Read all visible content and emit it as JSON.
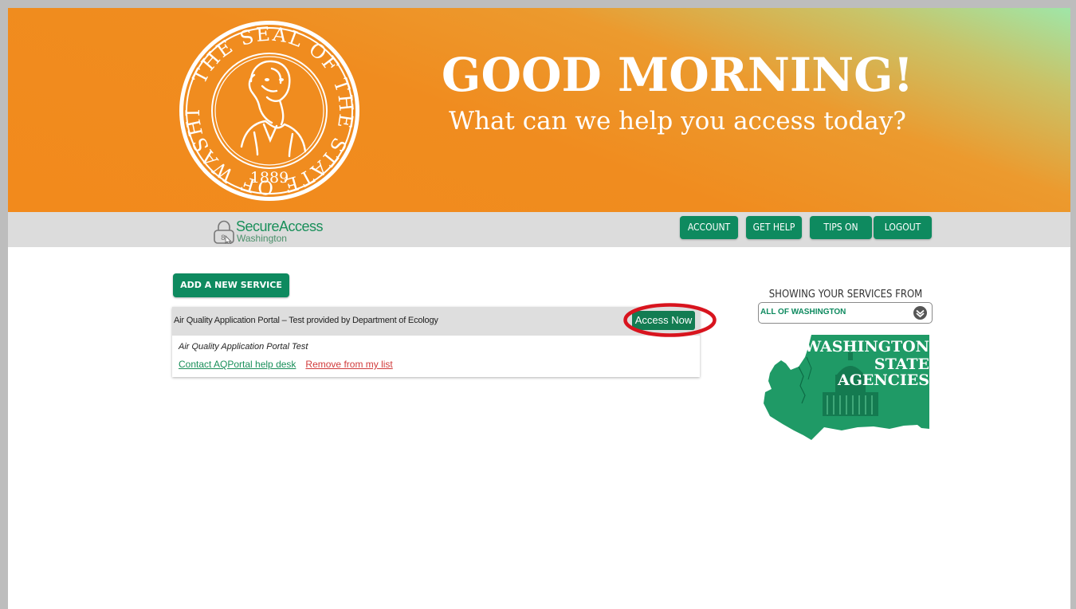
{
  "hero": {
    "greeting": "GOOD MORNING!",
    "subgreeting": "What can we help you access today?",
    "seal": {
      "ring_text": "THE SEAL OF THE STATE OF WASHINGTON",
      "year": "1889"
    }
  },
  "brand": {
    "title": "SecureAccess",
    "subtitle": "Washington"
  },
  "nav": {
    "account": "ACCOUNT",
    "get_help": "GET HELP",
    "tips": "TIPS ON",
    "logout": "LOGOUT"
  },
  "services": {
    "add_label": "ADD A NEW SERVICE",
    "items": [
      {
        "title": "Air Quality Application Portal – Test provided by Department of Ecology",
        "access_label": "Access Now",
        "description": "Air Quality Application Portal Test",
        "help_link": "Contact AQPortal help desk",
        "remove_link": "Remove from my list"
      }
    ]
  },
  "sidebar": {
    "heading": "SHOWING YOUR SERVICES FROM",
    "region_selected": "ALL OF WASHINGTON",
    "map_caption": {
      "line1": "WASHINGTON",
      "line2": "STATE",
      "line3": "AGENCIES"
    }
  },
  "colors": {
    "brand_green": "#0e8a5f",
    "hero_orange": "#f28a1c",
    "highlight_red": "#d8141e",
    "remove_red": "#d13b3b"
  }
}
